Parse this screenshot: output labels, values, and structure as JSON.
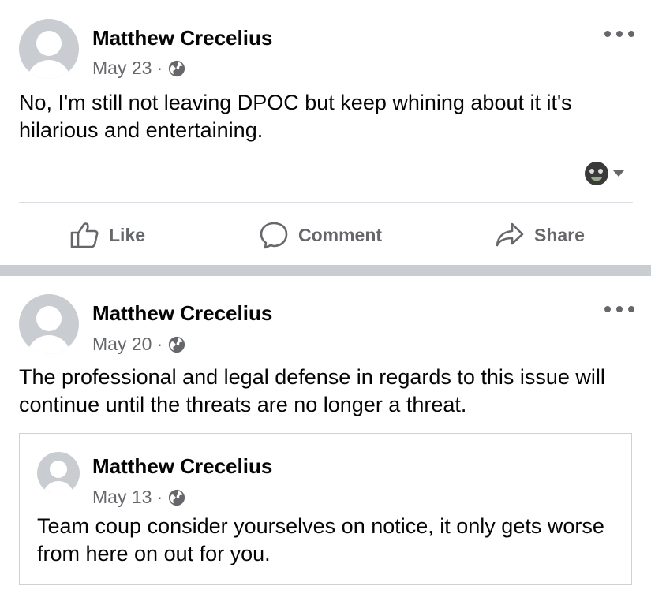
{
  "posts": [
    {
      "author": "Matthew Crecelius",
      "date": "May 23",
      "separator": "·",
      "privacy_icon": "globe-icon",
      "text": "No, I'm still not leaving DPOC but keep whining about it it's hilarious and entertaining.",
      "actions": {
        "like": "Like",
        "comment": "Comment",
        "share": "Share"
      }
    },
    {
      "author": "Matthew Crecelius",
      "date": "May 20",
      "separator": "·",
      "privacy_icon": "globe-icon",
      "text": "The professional and legal defense in regards to this issue will continue until the threats are no longer a threat.",
      "shared_post": {
        "author": "Matthew Crecelius",
        "date": "May 13",
        "separator": "·",
        "privacy_icon": "globe-icon",
        "text": "Team coup consider yourselves on notice, it only gets worse from here on out for you."
      }
    }
  ],
  "colors": {
    "secondary_text": "#65676b",
    "divider": "#dadde1",
    "band": "#c9ccd1",
    "avatar": "#c9ccd1"
  }
}
